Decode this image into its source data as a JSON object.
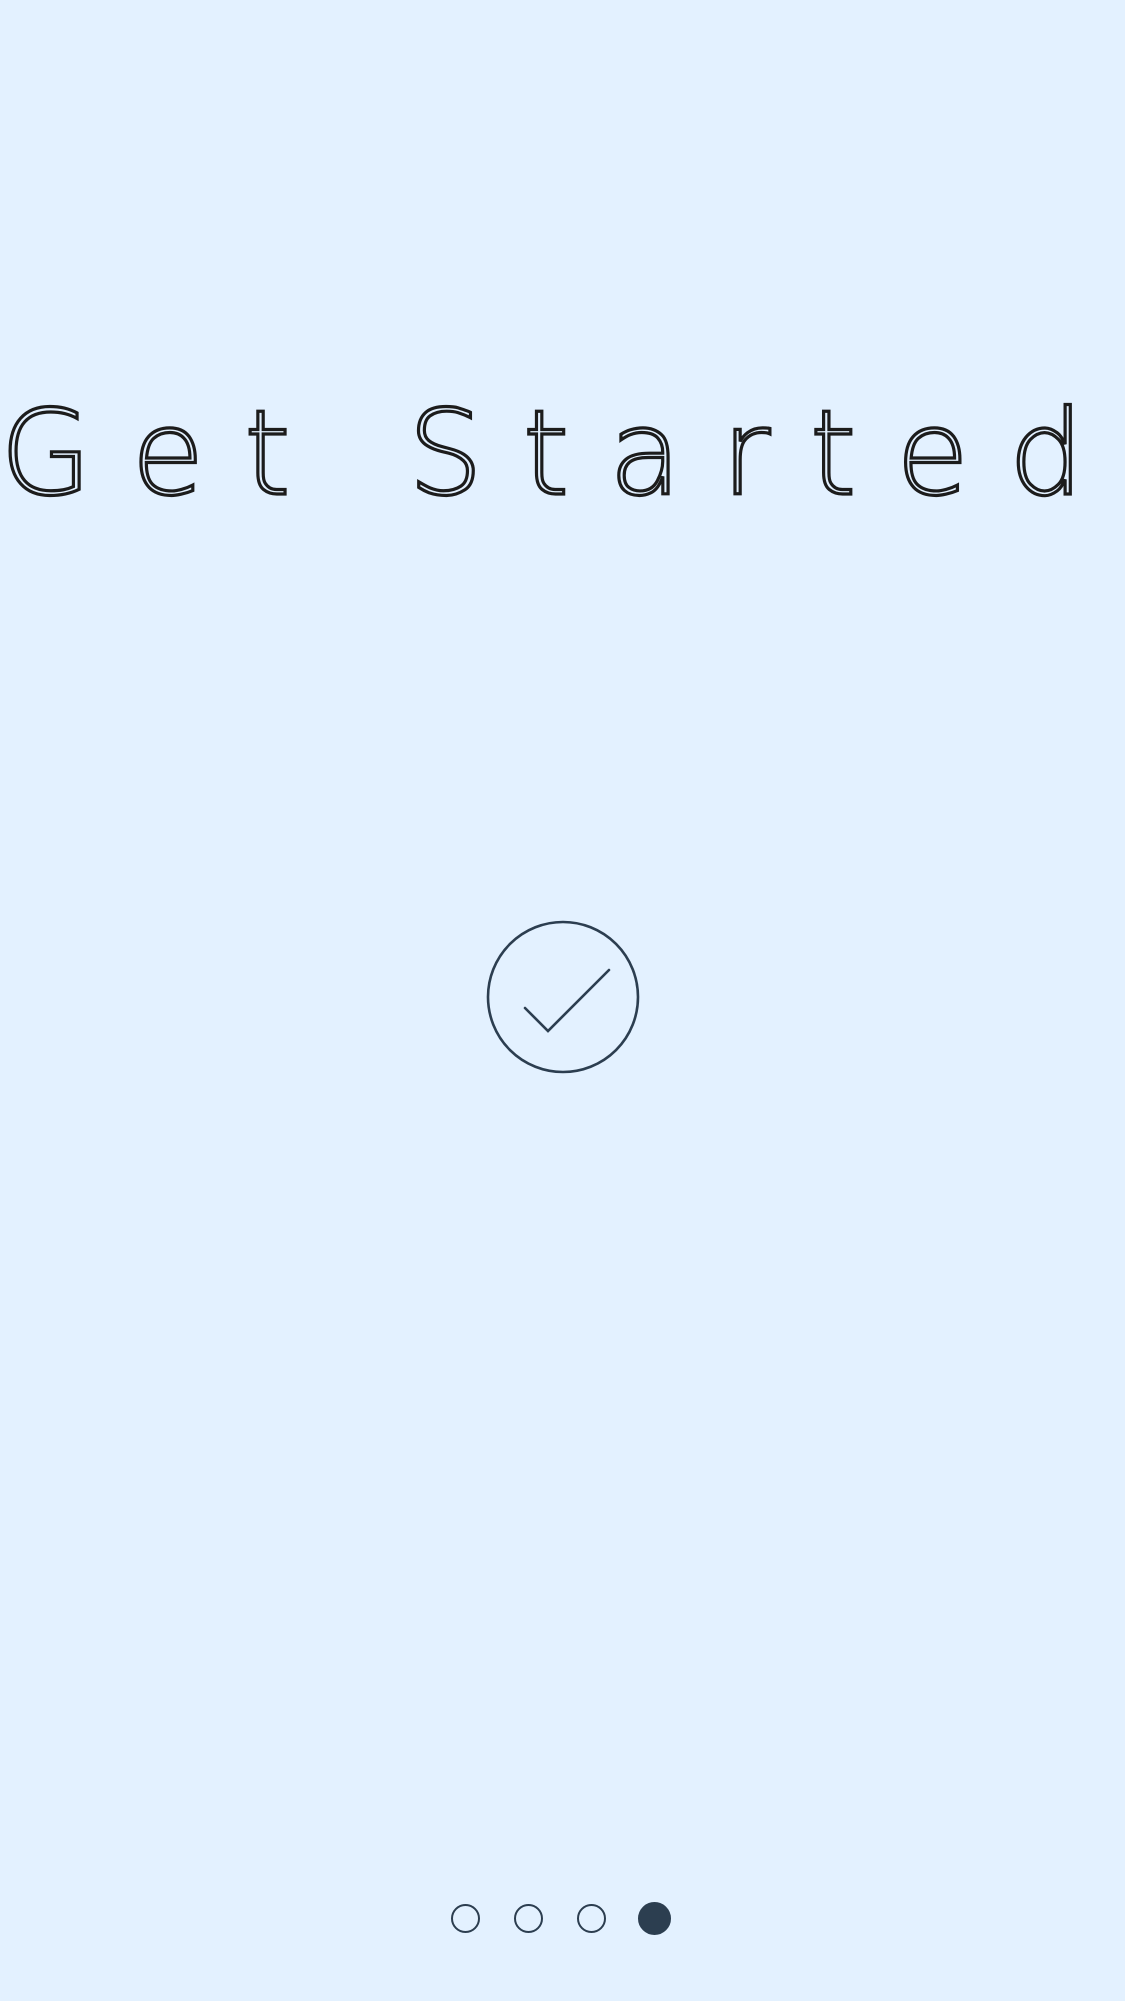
{
  "onboarding": {
    "title": "Get Started",
    "icon": "check-circle-icon",
    "pager": {
      "total": 4,
      "active_index": 4
    }
  },
  "colors": {
    "background": "#e3f1ff",
    "accent": "#2c3e50",
    "title": "#1c1c1c"
  }
}
